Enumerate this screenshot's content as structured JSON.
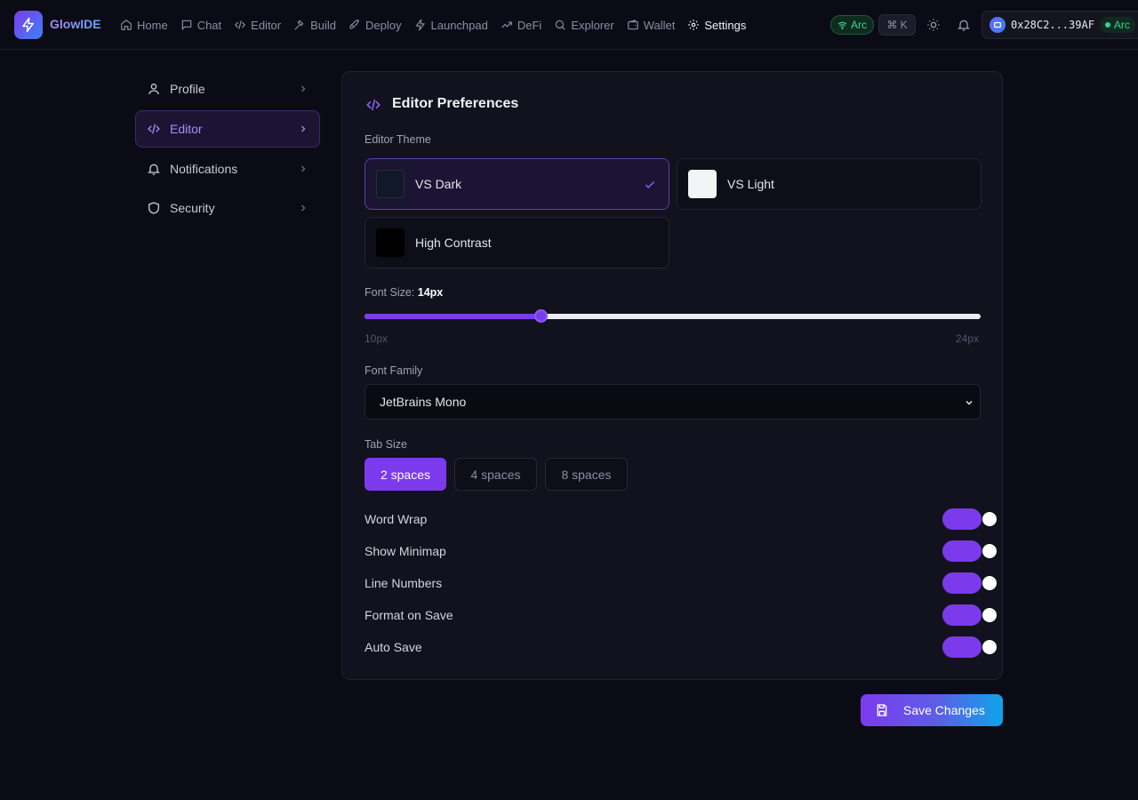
{
  "app": {
    "name": "GlowIDE",
    "logo_icon": "lightning-icon",
    "accent": "#7c3aed",
    "accent_secondary": "#0ea5e9"
  },
  "topnav": {
    "items": [
      {
        "label": "Home",
        "icon": "home-icon",
        "active": false
      },
      {
        "label": "Chat",
        "icon": "chat-icon",
        "active": false
      },
      {
        "label": "Editor",
        "icon": "code-icon",
        "active": false
      },
      {
        "label": "Build",
        "icon": "hammer-icon",
        "active": false
      },
      {
        "label": "Deploy",
        "icon": "rocket-icon",
        "active": false
      },
      {
        "label": "Launchpad",
        "icon": "lightning-icon",
        "active": false
      },
      {
        "label": "DeFi",
        "icon": "trending-up-icon",
        "active": false
      },
      {
        "label": "Explorer",
        "icon": "search-icon",
        "active": false
      },
      {
        "label": "Wallet",
        "icon": "wallet-icon",
        "active": false
      },
      {
        "label": "Settings",
        "icon": "gear-icon",
        "active": true
      }
    ],
    "network_badge": "Arc",
    "command_shortcut": "⌘ K",
    "wallet_address": "0x28C2...39AF",
    "wallet_chain": "Arc"
  },
  "sidebar": {
    "items": [
      {
        "label": "Profile",
        "icon": "user-icon",
        "active": false
      },
      {
        "label": "Editor",
        "icon": "code-icon",
        "active": true
      },
      {
        "label": "Notifications",
        "icon": "bell-icon",
        "active": false
      },
      {
        "label": "Security",
        "icon": "shield-icon",
        "active": false
      }
    ]
  },
  "panel": {
    "title": "Editor Preferences",
    "theme": {
      "label": "Editor Theme",
      "options": [
        {
          "name": "VS Dark",
          "swatch": "#111827",
          "selected": true
        },
        {
          "name": "VS Light",
          "swatch": "#f3f4f6",
          "selected": false
        },
        {
          "name": "High Contrast",
          "swatch": "#000000",
          "selected": false
        }
      ]
    },
    "font_size": {
      "label": "Font Size: ",
      "value_text": "14px",
      "value": 14,
      "min": 10,
      "max": 24,
      "min_label": "10px",
      "max_label": "24px"
    },
    "font_family": {
      "label": "Font Family",
      "selected": "JetBrains Mono"
    },
    "tab_size": {
      "label": "Tab Size",
      "options": [
        {
          "label": "2 spaces",
          "selected": true
        },
        {
          "label": "4 spaces",
          "selected": false
        },
        {
          "label": "8 spaces",
          "selected": false
        }
      ]
    },
    "toggles": [
      {
        "label": "Word Wrap",
        "on": true
      },
      {
        "label": "Show Minimap",
        "on": true
      },
      {
        "label": "Line Numbers",
        "on": true
      },
      {
        "label": "Format on Save",
        "on": true
      },
      {
        "label": "Auto Save",
        "on": true
      }
    ]
  },
  "save_button": {
    "label": "Save Changes",
    "icon": "save-icon"
  }
}
